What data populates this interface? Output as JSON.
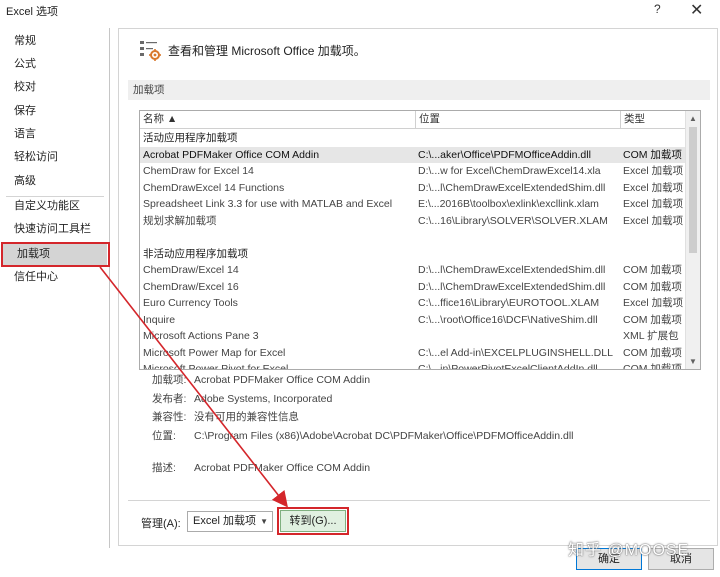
{
  "window": {
    "title": "Excel 选项",
    "help": "?",
    "close": "✕"
  },
  "sidebar": {
    "items": [
      {
        "label": "常规"
      },
      {
        "label": "公式"
      },
      {
        "label": "校对"
      },
      {
        "label": "保存"
      },
      {
        "label": "语言"
      },
      {
        "label": "轻松访问"
      },
      {
        "label": "高级"
      },
      {
        "label": "自定义功能区"
      },
      {
        "label": "快速访问工具栏"
      },
      {
        "label": "加载项"
      },
      {
        "label": "信任中心"
      }
    ],
    "active_index": 9
  },
  "header": {
    "title": "查看和管理 Microsoft Office 加载项。",
    "icon": "addins-gear-icon"
  },
  "section": {
    "label": "加载项"
  },
  "table": {
    "columns": [
      "名称 ▲",
      "位置",
      "类型"
    ],
    "groups": [
      {
        "title": "活动应用程序加载项",
        "rows": [
          {
            "name": "Acrobat PDFMaker Office COM Addin",
            "location": "C:\\...aker\\Office\\PDFMOfficeAddin.dll",
            "type": "COM 加载项"
          },
          {
            "name": "ChemDraw for Excel 14",
            "location": "D:\\...w for Excel\\ChemDrawExcel14.xla",
            "type": "Excel 加载项"
          },
          {
            "name": "ChemDrawExcel 14 Functions",
            "location": "D:\\...l\\ChemDrawExcelExtendedShim.dll",
            "type": "Excel 加载项"
          },
          {
            "name": "Spreadsheet Link 3.3 for use with MATLAB and Excel",
            "location": "E:\\...2016B\\toolbox\\exlink\\excllink.xlam",
            "type": "Excel 加载项"
          },
          {
            "name": "规划求解加载项",
            "location": "C:\\...16\\Library\\SOLVER\\SOLVER.XLAM",
            "type": "Excel 加载项"
          }
        ]
      },
      {
        "title": "非活动应用程序加载项",
        "rows": [
          {
            "name": "ChemDraw/Excel 14",
            "location": "D:\\...l\\ChemDrawExcelExtendedShim.dll",
            "type": "COM 加载项"
          },
          {
            "name": "ChemDraw/Excel 16",
            "location": "D:\\...l\\ChemDrawExcelExtendedShim.dll",
            "type": "COM 加载项"
          },
          {
            "name": "Euro Currency Tools",
            "location": "C:\\...ffice16\\Library\\EUROTOOL.XLAM",
            "type": "Excel 加载项"
          },
          {
            "name": "Inquire",
            "location": "C:\\...\\root\\Office16\\DCF\\NativeShim.dll",
            "type": "COM 加载项"
          },
          {
            "name": "Microsoft Actions Pane 3",
            "location": "",
            "type": "XML 扩展包"
          },
          {
            "name": "Microsoft Power Map for Excel",
            "location": "C:\\...el Add-in\\EXCELPLUGINSHELL.DLL",
            "type": "COM 加载项"
          },
          {
            "name": "Microsoft Power Pivot for Excel",
            "location": "C:\\...in\\PowerPivotExcelClientAddIn.dll",
            "type": "COM 加载项"
          }
        ]
      }
    ],
    "selected": "Acrobat PDFMaker Office COM Addin"
  },
  "details": {
    "addin_label": "加载项:",
    "addin_value": "Acrobat PDFMaker Office COM Addin",
    "publisher_label": "发布者:",
    "publisher_value": "Adobe Systems, Incorporated",
    "compat_label": "兼容性:",
    "compat_value": "没有可用的兼容性信息",
    "location_label": "位置:",
    "location_value": "C:\\Program Files (x86)\\Adobe\\Acrobat DC\\PDFMaker\\Office\\PDFMOfficeAddin.dll",
    "desc_label": "描述:",
    "desc_value": "Acrobat PDFMaker Office COM Addin"
  },
  "manage": {
    "label": "管理(A):",
    "selected": "Excel 加载项",
    "go_button": "转到(G)..."
  },
  "footer": {
    "ok": "确定",
    "cancel": "取消"
  },
  "watermark": "知乎 @MOOSE",
  "colors": {
    "highlight": "#d4262b",
    "selected_row": "#e6e6e6",
    "sidebar_active": "#d4d4d4"
  }
}
